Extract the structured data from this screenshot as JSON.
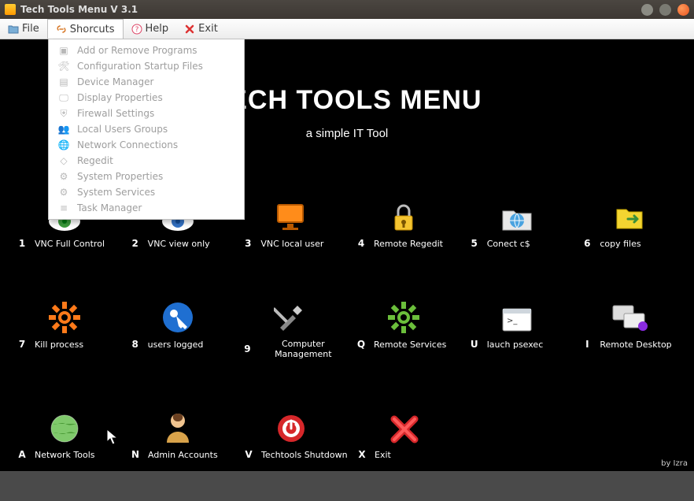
{
  "window": {
    "title": "Tech Tools Menu V 3.1"
  },
  "menubar": {
    "file": "File",
    "shortcuts": "Shorcuts",
    "help": "Help",
    "exit": "Exit"
  },
  "dropdown": {
    "items": [
      {
        "label": "Add or Remove Programs"
      },
      {
        "label": "Configuration Startup Files"
      },
      {
        "label": "Device Manager"
      },
      {
        "label": "Display Properties"
      },
      {
        "label": "Firewall Settings"
      },
      {
        "label": "Local Users  Groups"
      },
      {
        "label": "Network Connections"
      },
      {
        "label": "Regedit"
      },
      {
        "label": "System Properties"
      },
      {
        "label": "System Services"
      },
      {
        "label": "Task Manager"
      }
    ]
  },
  "headline": {
    "title": "TECH TOOLS MENU",
    "subtitle": "a simple IT Tool"
  },
  "rows": [
    [
      {
        "key": "1",
        "label": "VNC Full Control"
      },
      {
        "key": "2",
        "label": "VNC view only"
      },
      {
        "key": "3",
        "label": "VNC local user"
      },
      {
        "key": "4",
        "label": "Remote Regedit"
      },
      {
        "key": "5",
        "label": "Conect c$"
      },
      {
        "key": "6",
        "label": "copy files"
      }
    ],
    [
      {
        "key": "7",
        "label": "Kill process"
      },
      {
        "key": "8",
        "label": "users logged"
      },
      {
        "key": "9",
        "label": "Computer Management"
      },
      {
        "key": "Q",
        "label": "Remote Services"
      },
      {
        "key": "U",
        "label": "lauch psexec"
      },
      {
        "key": "I",
        "label": "Remote Desktop"
      }
    ],
    [
      {
        "key": "A",
        "label": "Network Tools"
      },
      {
        "key": "N",
        "label": "Admin  Accounts"
      },
      {
        "key": "V",
        "label": "Techtools Shutdown"
      },
      {
        "key": "X",
        "label": "Exit"
      }
    ]
  ],
  "footer": "by Izra"
}
